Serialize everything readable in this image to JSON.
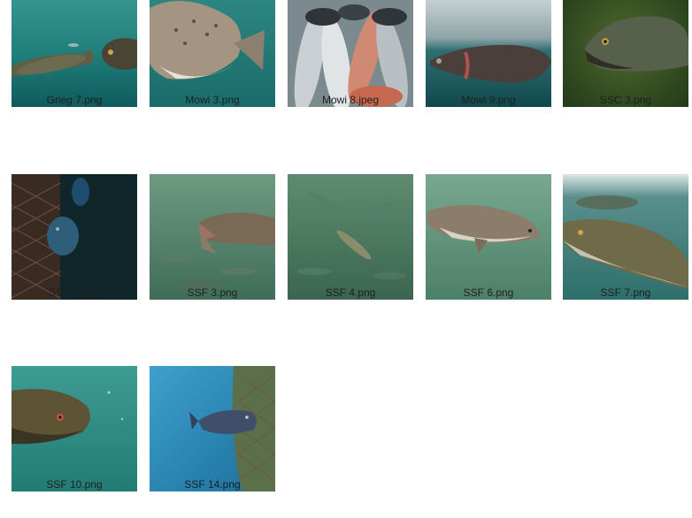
{
  "gallery": {
    "items": [
      {
        "label": "Grieg 7.png",
        "scene": "two salmon swimming in teal water"
      },
      {
        "label": "Mowi 3.png",
        "scene": "spotted salmon close-up underwater"
      },
      {
        "label": "Mowi 8.jpeg",
        "scene": "pile of harvested salmon"
      },
      {
        "label": "Mowi 9.png",
        "scene": "salmon near water surface"
      },
      {
        "label": "SSC 3.png",
        "scene": "salmon head in green water"
      },
      {
        "label": "SSC 4.png",
        "scene": "fish beside dark net pen"
      },
      {
        "label": "SSF 3.png",
        "scene": "school of salmon in green water"
      },
      {
        "label": "SSF 4.png",
        "scene": "salmon shoal in murky green water"
      },
      {
        "label": "SSF 6.png",
        "scene": "single salmon in green water"
      },
      {
        "label": "SSF 7.png",
        "scene": "salmon close to surface"
      },
      {
        "label": "SSF 10.png",
        "scene": "salmon head close-up"
      },
      {
        "label": "SSF 14.png",
        "scene": "fish beside net in blue water"
      }
    ]
  },
  "colors": {
    "background": "#ffffff",
    "label_text": "#1f1f1f"
  }
}
